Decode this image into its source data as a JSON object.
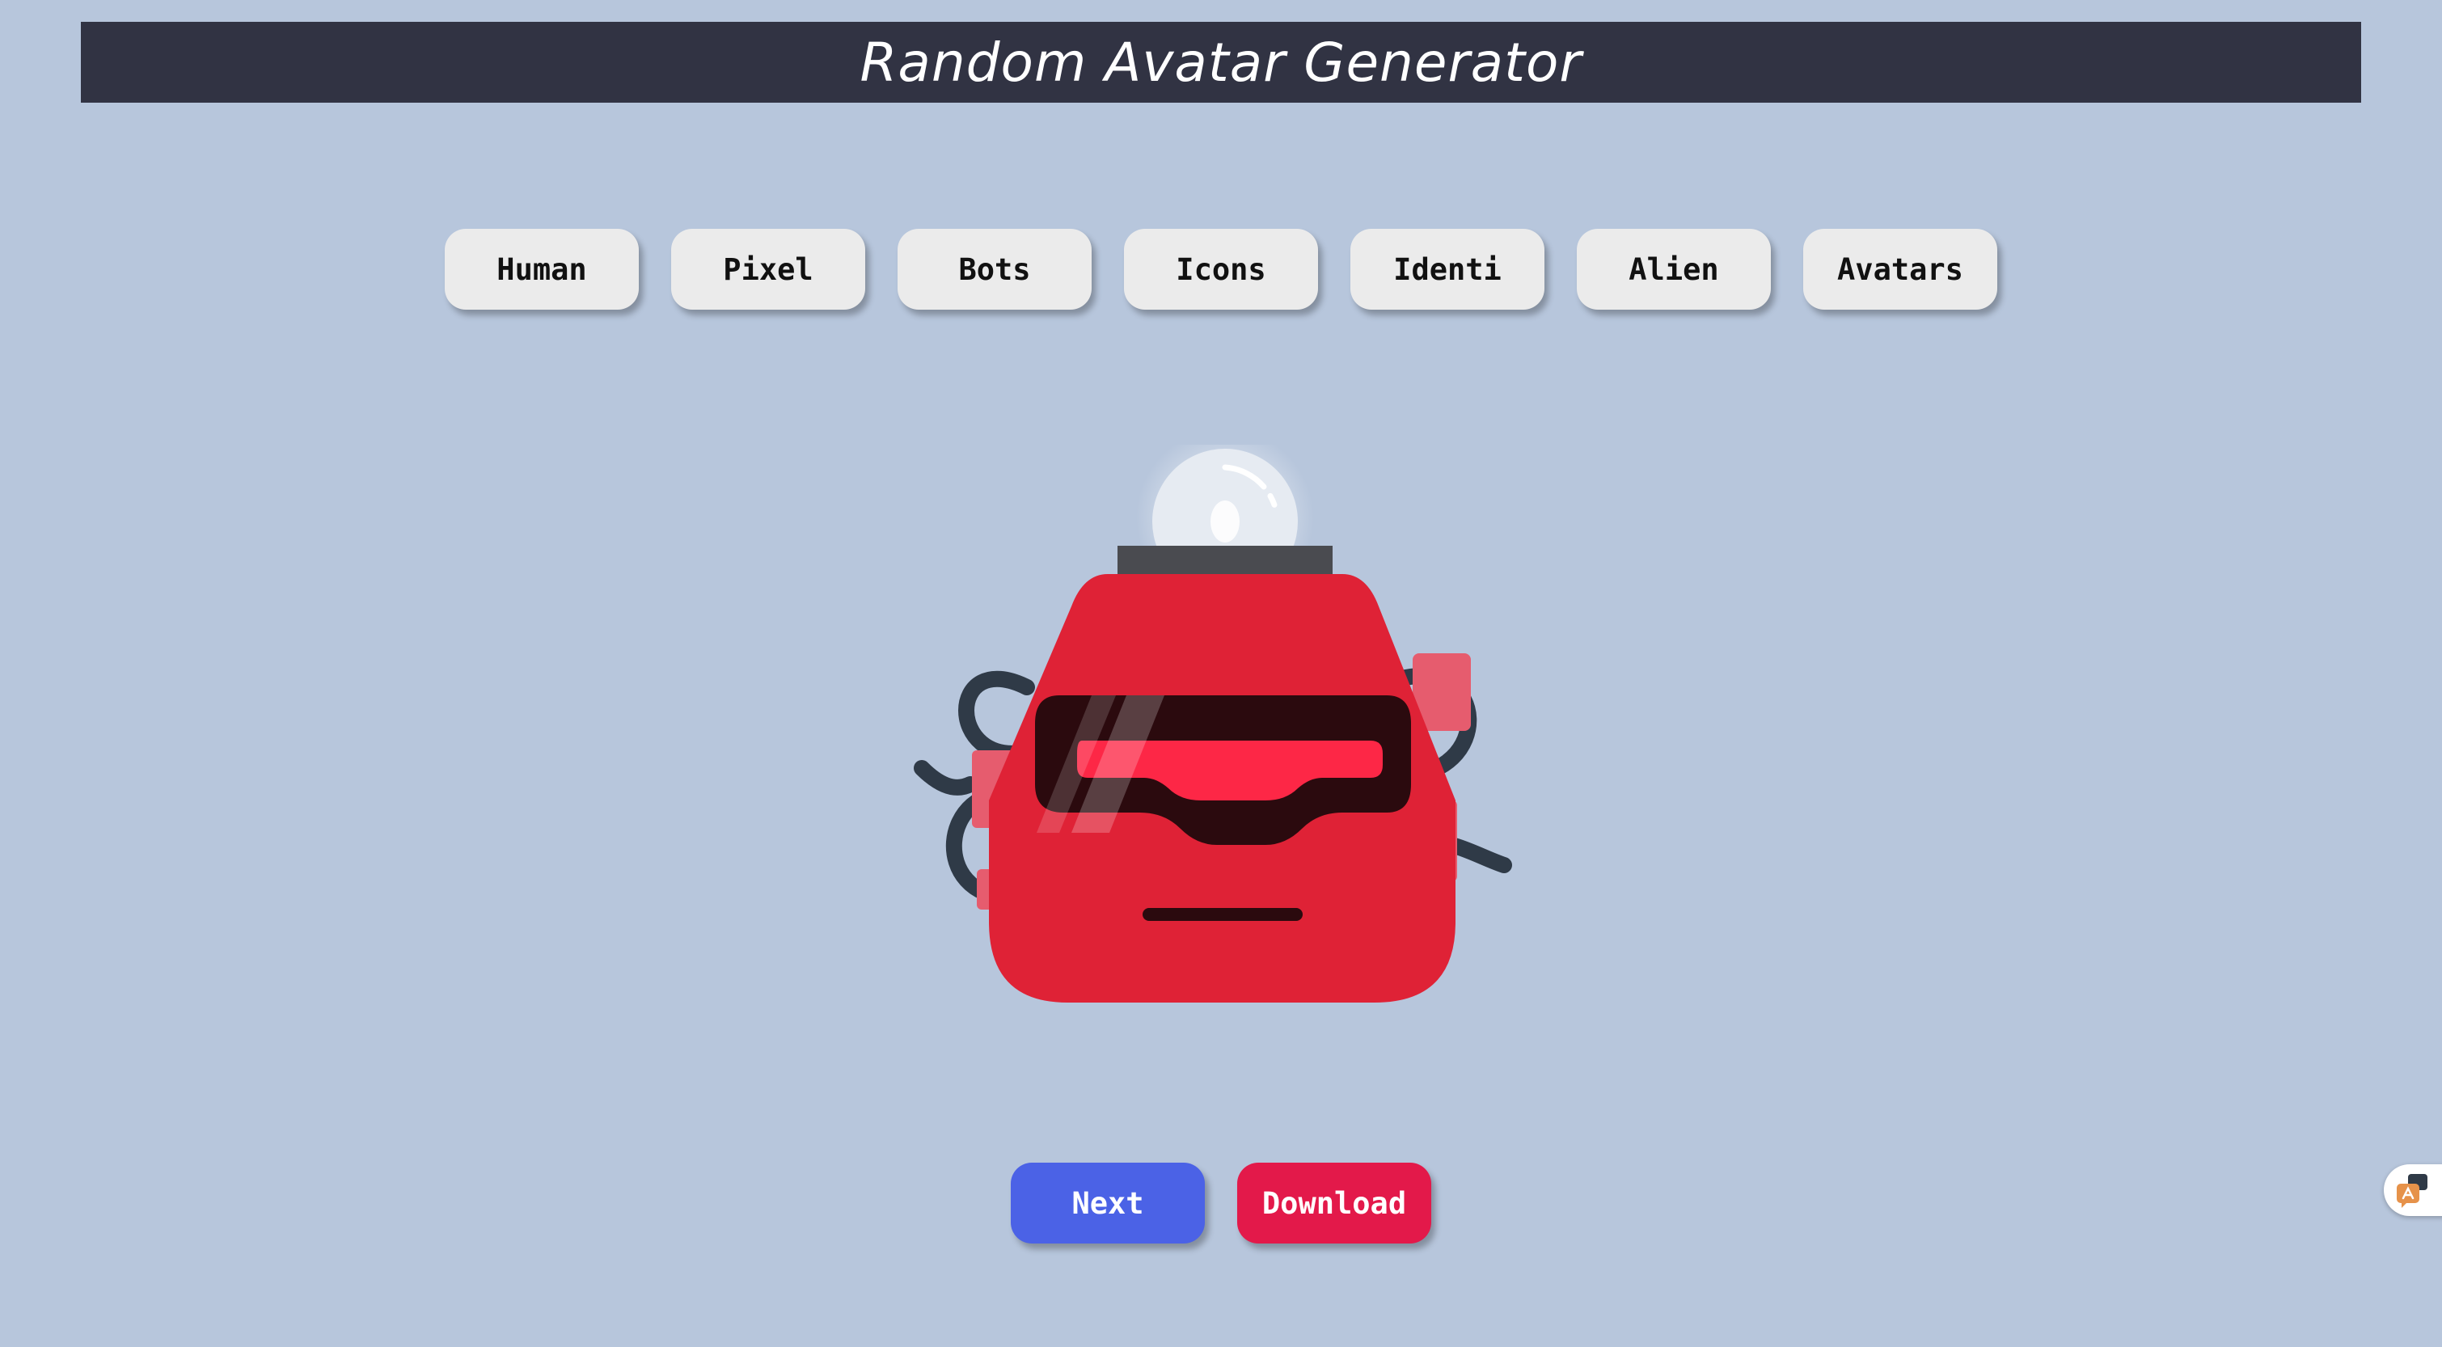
{
  "header": {
    "title": "Random Avatar Generator"
  },
  "categories": [
    {
      "label": "Human"
    },
    {
      "label": "Pixel"
    },
    {
      "label": "Bots"
    },
    {
      "label": "Icons"
    },
    {
      "label": "Identi"
    },
    {
      "label": "Alien"
    },
    {
      "label": "Avatars"
    }
  ],
  "actions": {
    "next_label": "Next",
    "download_label": "Download"
  },
  "avatar": {
    "type": "robot",
    "colors": {
      "body": "#df2236",
      "visor": "#2b0a0e",
      "eye": "#fd2746",
      "cap": "#4a4b50",
      "bulb": "#e6ebf2",
      "side_plate": "#e65c6e",
      "cables": "#2f3a47"
    }
  },
  "colors": {
    "background": "#b7c6dc",
    "header": "#313343",
    "category_button": "#ebebeb",
    "next_button": "#4b62e6",
    "download_button": "#e3194a"
  },
  "icons": {
    "floating_widget": "translate-chat-icon"
  }
}
